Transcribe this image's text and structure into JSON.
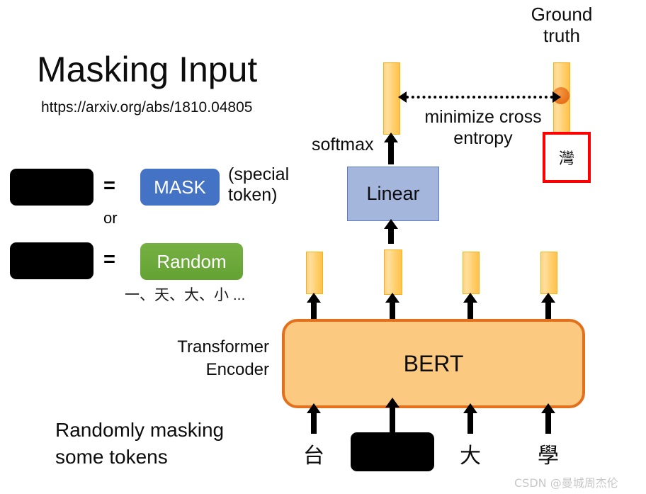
{
  "slide": {
    "title": "Masking Input",
    "url": "https://arxiv.org/abs/1810.04805",
    "watermark": "CSDN @曼城周杰伦"
  },
  "legend": {
    "equals_1": "=",
    "equals_2": "=",
    "or": "or",
    "mask_label": "MASK",
    "mask_note": "(special token)",
    "random_label": "Random",
    "random_examples": "一、天、大、小 ...",
    "mask_color": "#4472C4",
    "random_color": "#64A234",
    "blackbox_color": "#000000"
  },
  "model": {
    "bert_label": "BERT",
    "bert_fill": "#FBC97F",
    "bert_border": "#E2701C",
    "encoder_label": "Transformer\nEncoder",
    "encoder_line1": "Transformer",
    "encoder_line2": "Encoder",
    "linear_label": "Linear",
    "linear_fill": "#A5B6DC",
    "softmax_label": "softmax",
    "bar_color": "#FFCE6B"
  },
  "loss": {
    "objective_line1": "minimize cross",
    "objective_line2": "entropy",
    "ground_truth_line1": "Ground",
    "ground_truth_line2": "truth",
    "ground_truth_token": "灣",
    "highlight_border": "#FF0000",
    "dot_color": "#E8701A"
  },
  "caption": {
    "line1": "Randomly masking",
    "line2": "some tokens"
  },
  "input_tokens": [
    {
      "text": "台",
      "masked": false
    },
    {
      "text": "",
      "masked": true
    },
    {
      "text": "大",
      "masked": false
    },
    {
      "text": "學",
      "masked": false
    }
  ]
}
